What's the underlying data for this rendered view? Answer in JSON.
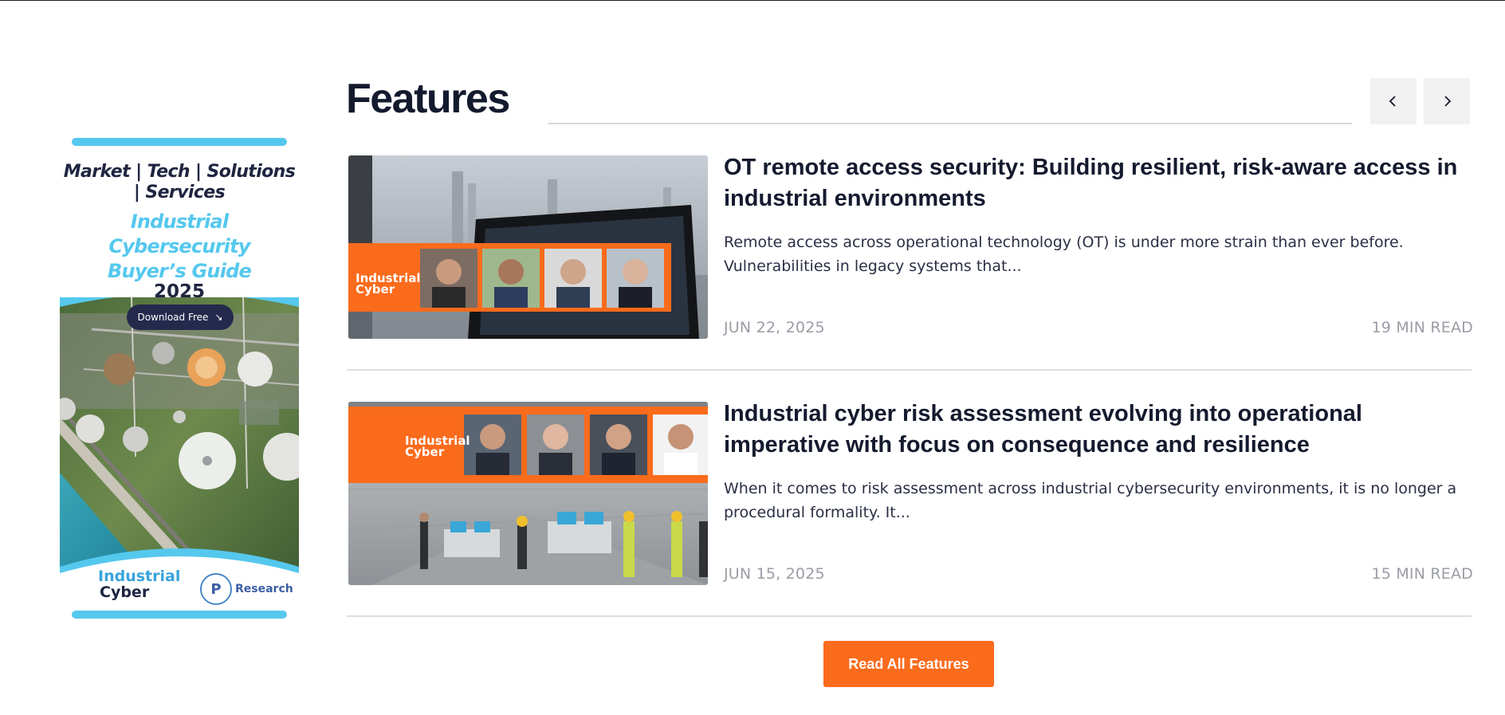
{
  "section": {
    "title": "Features",
    "prev_icon": "chevron-left-icon",
    "next_icon": "chevron-right-icon",
    "cta_label": "Read All Features"
  },
  "ad": {
    "tagline": "Market | Tech | Solutions | Services",
    "title": "Industrial Cybersecurity Buyer’s Guide",
    "year": "2025",
    "download_label": "Download Free",
    "download_icon": "arrow-down-right-icon",
    "logo_industrial": "Industrial",
    "logo_cyber": "Cyber",
    "logo_research": "Research"
  },
  "articles": [
    {
      "title": "OT remote access security: Building resilient, risk-aware access in industrial environments",
      "excerpt": "Remote access across operational technology (OT) is under more strain than ever before. Vulnerabilities in legacy systems that...",
      "date": "JUN 22, 2025",
      "read_time": "19 MIN READ",
      "banner_logo_1": "Industrial",
      "banner_logo_2": "Cyber"
    },
    {
      "title": "Industrial cyber risk assessment evolving into operational imperative with focus on consequence and resilience",
      "excerpt": "When it comes to risk assessment across industrial cybersecurity environments, it is no longer a procedural formality. It...",
      "date": "JUN 15, 2025",
      "read_time": "15 MIN READ",
      "banner_logo_1": "Industrial",
      "banner_logo_2": "Cyber"
    }
  ],
  "colors": {
    "accent": "#fb6b1c",
    "ad_blue": "#55c8ee",
    "heading": "#141a2e",
    "meta": "#9b9da6"
  }
}
